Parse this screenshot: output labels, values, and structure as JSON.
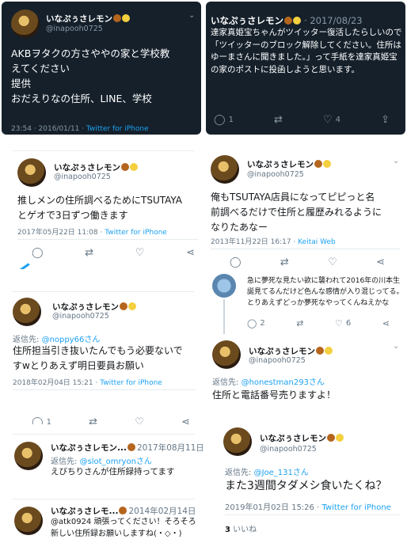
{
  "colors": {
    "dark_bg": "#15202b",
    "link": "#1da1f2",
    "muted": "#657786"
  },
  "icons": [
    "reply-icon",
    "retweet-icon",
    "heart-icon",
    "share-icon",
    "chevron-down-icon"
  ],
  "t1": {
    "name": "いなぷぅさレモン",
    "handle": "@inapooh0725",
    "text": "AKBヲタクの方さややの家と学校教\nえてください\n提供\nおだえりなの住所、LINE、学校",
    "time": "23:54 · 2016/01/11 · ",
    "via": "Twitter for iPhone"
  },
  "t2": {
    "name": "いなぷぅさレモン",
    "date": "· 2017/08/23",
    "handle": "@inapooh0725",
    "text": "達家真姫宝ちゃんがツイッター復活したらしいので\n「ツイッターのブロック解除してください。住所はゆーまさんに聞きました。」って手紙を達家真姫宝の家のポストに投函しようと思います。",
    "reply_count": "1",
    "like_count": "4"
  },
  "t3": {
    "name": "いなぷぅさレモン",
    "handle": "@inapooh0725",
    "text": "推しメンの住所調べるためにTSUTAYA\nとゲオで3日ずつ働きます",
    "time": "2017年05月22日 11:08 · ",
    "via": "Twitter for iPhone"
  },
  "t4": {
    "name": "いなぷぅさレモン",
    "handle": "@inapooh0725",
    "text": "俺もTSUTAYA店員になってピピっと名\n前調べるだけで住所と履歴みれるように\nなりたあなー",
    "time": "2013年11月22日 16:17 · ",
    "via": "Keitai Web"
  },
  "t5": {
    "text": "急に夢死な見たい欲に襲われて2016年の川本生\n誕見てるんだけど色んな感情が入り混じってる。\nとりあえずどっか夢死なやってくんねえかな",
    "reply_count": "2",
    "like_count": "6"
  },
  "t6": {
    "name": "いなぷぅさレモン",
    "handle": "@inapooh0725",
    "reply_label": "返信先: ",
    "reply_handle": "@noppy66さん",
    "text": "住所担当引き抜いたんでもう必要ないで\nすwとりあえず明日要員お願い",
    "time": "2018年02月04日 15:21 · ",
    "via": "Twitter for iPhone",
    "reply_count": "1"
  },
  "t7": {
    "name": "いなぷぅさレモン",
    "handle": "@inapooh0725",
    "reply_label": "返信先: ",
    "reply_handle": "@honestman293さん",
    "text": "住所と電話番号売りますよ！"
  },
  "t8": {
    "name": "いなぷぅさレモン...",
    "date": "2017年08月11日",
    "reply_label": "返信先: ",
    "reply_handle": "@slot_omryonさん",
    "text": "えびちりさんが住所録持ってます"
  },
  "t9": {
    "name": "いなぷぅさレモン",
    "handle": "@inapooh0725",
    "reply_label": "返信先: ",
    "reply_handle": "@Joe_131さん",
    "text": "また3週間タダメシ食いたくね？",
    "time": "2019年01月02日 15:26 · ",
    "via": "Twitter for iPhone",
    "likes_num": "3",
    "likes_label": " いいね"
  },
  "t10": {
    "name": "いなぷぅさレモ...",
    "date": "2014年02月14日",
    "text": "@atk0924 頑張ってください！そろそろ\n新しい住所録お願いしますね(・◇・)"
  }
}
